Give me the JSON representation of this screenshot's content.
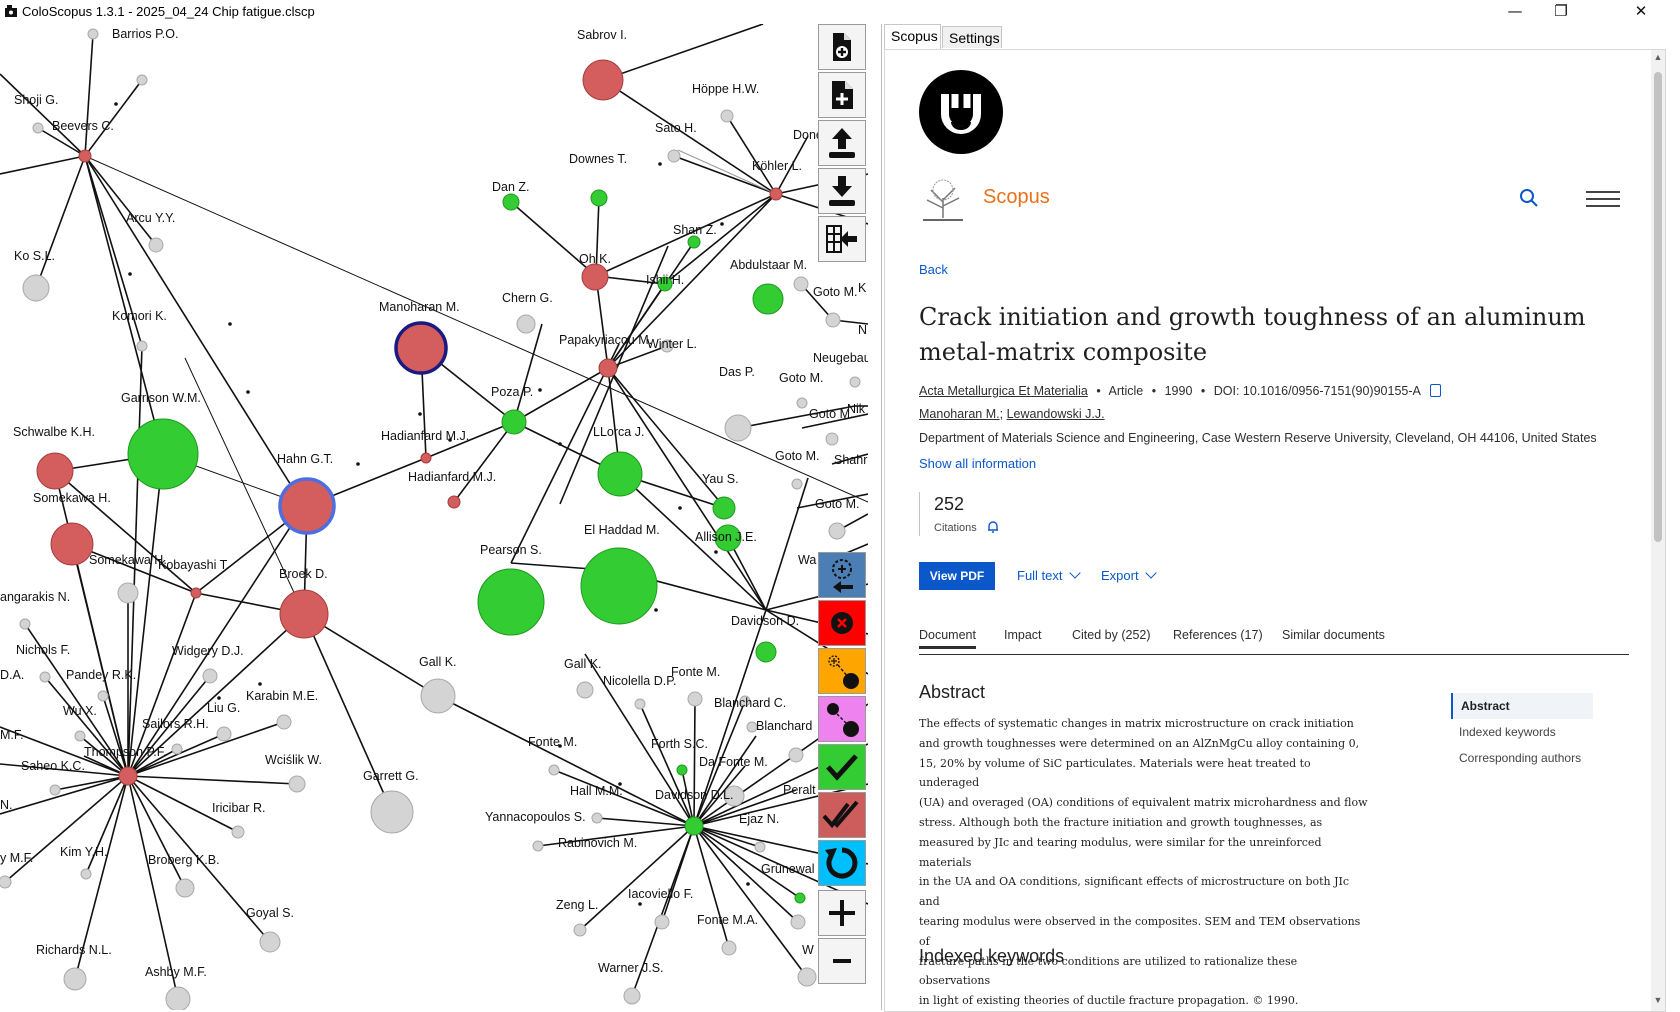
{
  "window": {
    "title": "ColoScopus 1.3.1 - 2025_04_24 Chip fatigue.clscp",
    "controls": {
      "minimize": "—",
      "maximize": "❐",
      "close": "✕"
    }
  },
  "graph": {
    "node_labels": [
      "Barrios P.O.",
      "Shoji G.",
      "Beevers C.",
      "Arcu Y.Y.",
      "Ko S.L.",
      "Komori K.",
      "Garrison W.M.",
      "Schwalbe K.H.",
      "Somekawa H.",
      "Somekawa H.",
      "Kobayashi T.",
      "angarakis N.",
      "Nichols F.",
      "D.A.",
      "Pandey R.K.",
      "Wu X.",
      "M.F.",
      "Thompson P.F.",
      "Saheo K.C.",
      "N.",
      "y M.F.",
      "Kim Y.H.",
      "Broberg K.B.",
      "Richards N.L.",
      "Ashby M.F.",
      "Goyal S.",
      "Iricibar R.",
      "Wciślik W.",
      "Liu G.",
      "Sailors R.H.",
      "Widgery D.J.",
      "Karabin M.E.",
      "Garrett G.",
      "Gall K.",
      "Broek D.",
      "Hahn G.T.",
      "Manoharan M.",
      "Hadianfard M.J.",
      "Hadianfard M.J.",
      "Poza P.",
      "Chern G.",
      "Dan Z.",
      "Oh K.",
      "Downes T.",
      "Sabrov I.",
      "Höppe H.W.",
      "Sato H.",
      "Done",
      "Köhler L.",
      "Shan Z.",
      "Ishii H.",
      "Abdulstaar M.",
      "Goto M.",
      "K",
      "N",
      "Papakyriacou M.",
      "Winter L.",
      "Das P.",
      "Goto M.",
      "Neugebau",
      "Goto M.",
      "Nik",
      "Goto M.",
      "Shahr",
      "Goto M.",
      "Wa",
      "LLorca J.",
      "Yau S.",
      "Allison J.E.",
      "Pearson S.",
      "El Haddad M.",
      "Davidson D.",
      "Gall K.",
      "Nicolella D.P.",
      "Fonte M.",
      "Blanchard C.",
      "Blanchard",
      "Fonte M.",
      "Forth S.C.",
      "Da Fonte M.",
      "Peralt",
      "Hall M.M.",
      "Davidson D.L.",
      "Yannacopoulos S.",
      "Ejaz N.",
      "Rabinovich M.",
      "Grünewal",
      "Zeng L.",
      "Iacoviello F.",
      "Fonte M.A.",
      "Warner J.S.",
      "W"
    ],
    "colors": {
      "red": "#d45d5d",
      "green": "#33cc33",
      "gray": "#d4d4d4",
      "hub_ring": "#1a1a80",
      "ring": "#4d6ee0"
    }
  },
  "toolbar": {
    "buttons": [
      {
        "name": "add-file",
        "icon": "file-plus-circle-icon"
      },
      {
        "name": "new-file",
        "icon": "file-plus-icon"
      },
      {
        "name": "upload",
        "icon": "upload-icon"
      },
      {
        "name": "download",
        "icon": "download-icon"
      },
      {
        "name": "export-grid",
        "icon": "grid-export-icon"
      },
      {
        "name": "select-node",
        "icon": "target-arrow-icon",
        "color": "#4a7eb5"
      },
      {
        "name": "delete-node",
        "icon": "x-circle-icon",
        "color": "#ff0000"
      },
      {
        "name": "connect-node",
        "icon": "link-target-icon",
        "color": "#ffa500"
      },
      {
        "name": "connect-nodes",
        "icon": "link-nodes-icon",
        "color": "#ee82ee"
      },
      {
        "name": "accept",
        "icon": "check-icon",
        "color": "#33cc33"
      },
      {
        "name": "accept-all",
        "icon": "double-check-icon",
        "color": "#cd5c5c"
      },
      {
        "name": "refresh",
        "icon": "circular-arrow-icon",
        "color": "#00bfff"
      },
      {
        "name": "zoom-in",
        "icon": "plus-icon"
      },
      {
        "name": "zoom-out",
        "icon": "minus-icon"
      }
    ]
  },
  "tabs": {
    "scopus": "Scopus",
    "settings": "Settings"
  },
  "scopus": {
    "brand": "Scopus",
    "back": "Back",
    "title": "Crack initiation and growth toughness of an aluminum metal-matrix composite",
    "journal": "Acta Metallurgica Et Materialia",
    "doc_type": "Article",
    "year": "1990",
    "doi": "DOI: 10.1016/0956-7151(90)90155-A",
    "bullet": "•",
    "author1": "Manoharan M.",
    "author_sep": ";",
    "author2": "Lewandowski J.J.",
    "affiliation": "Department of Materials Science and Engineering, Case Western Reserve University, Cleveland, OH 44106, United States",
    "show_all": "Show all information",
    "citations_count": "252",
    "citations_label": "Citations",
    "view_pdf": "View PDF",
    "full_text": "Full text",
    "export": "Export",
    "doc_tabs": [
      "Document",
      "Impact",
      "Cited by (252)",
      "References (17)",
      "Similar documents"
    ],
    "abstract_heading": "Abstract",
    "abstract_lines": [
      "The effects of systematic changes in matrix microstructure on crack initiation",
      "and growth toughnesses were determined on an AlZnMgCu alloy containing 0,",
      "15, 20% by volume of SiC particulates. Materials were heat treated to underaged",
      "(UA) and overaged (OA) conditions of equivalent matrix microhardness and flow",
      "stress. Although both the fracture initiation and growth toughnesses, as",
      "measured by JIc and tearing modulus, were similar for the unreinforced materials",
      "in the UA and OA conditions, significant effects of microstructure on both JIc and",
      "tearing modulus were observed in the composites. SEM and TEM observations of",
      "fracture paths in the two conditions are utilized to rationalize these observations",
      "in light of existing theories of ductile fracture propagation. © 1990."
    ],
    "side_nav": [
      "Abstract",
      "Indexed keywords",
      "Corresponding authors"
    ],
    "indexed_heading": "Indexed keywords"
  }
}
